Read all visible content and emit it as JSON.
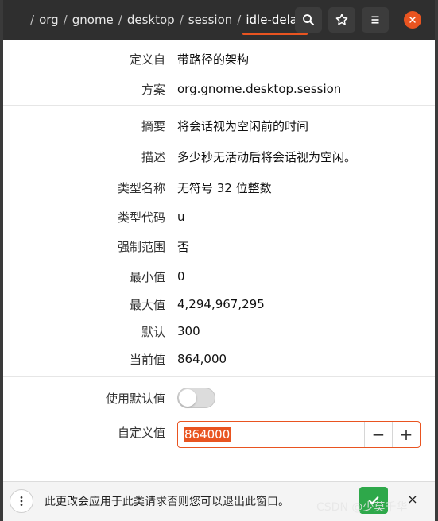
{
  "breadcrumb": {
    "items": [
      "org",
      "gnome",
      "desktop",
      "session"
    ],
    "active": "idle-delay",
    "separator": "/"
  },
  "toolbar": {
    "search_icon": "search-icon",
    "bookmark_icon": "star-icon",
    "menu_icon": "hamburger-icon",
    "close_icon": "close-icon"
  },
  "fields": {
    "defined_in": {
      "label": "定义自",
      "value": "带路径的架构"
    },
    "schema": {
      "label": "方案",
      "value": "org.gnome.desktop.session"
    },
    "summary": {
      "label": "摘要",
      "value": "将会话视为空闲前的时间"
    },
    "description": {
      "label": "描述",
      "value": "多少秒无活动后将会话视为空闲。"
    },
    "type_name": {
      "label": "类型名称",
      "value": "无符号 32 位整数"
    },
    "type_code": {
      "label": "类型代码",
      "value": "u"
    },
    "forced_range": {
      "label": "强制范围",
      "value": "否"
    },
    "min": {
      "label": "最小值",
      "value": "0"
    },
    "max": {
      "label": "最大值",
      "value": "4,294,967,295"
    },
    "default": {
      "label": "默认",
      "value": "300"
    },
    "current": {
      "label": "当前值",
      "value": "864,000"
    },
    "use_default": {
      "label": "使用默认值",
      "state": "off"
    },
    "custom_value": {
      "label": "自定义值",
      "value": "864000",
      "minus": "−",
      "plus": "+"
    }
  },
  "bottom": {
    "message": "此更改会应用于此类请求否则您可以退出此窗口。",
    "apply_icon": "checkmark-icon",
    "dismiss_icon": "close-icon",
    "dismiss_label": "×"
  },
  "watermark": "CSDN @少莫千华",
  "colors": {
    "accent": "#e95420",
    "apply": "#2ea84a",
    "titlebar": "#2f2f2f"
  }
}
